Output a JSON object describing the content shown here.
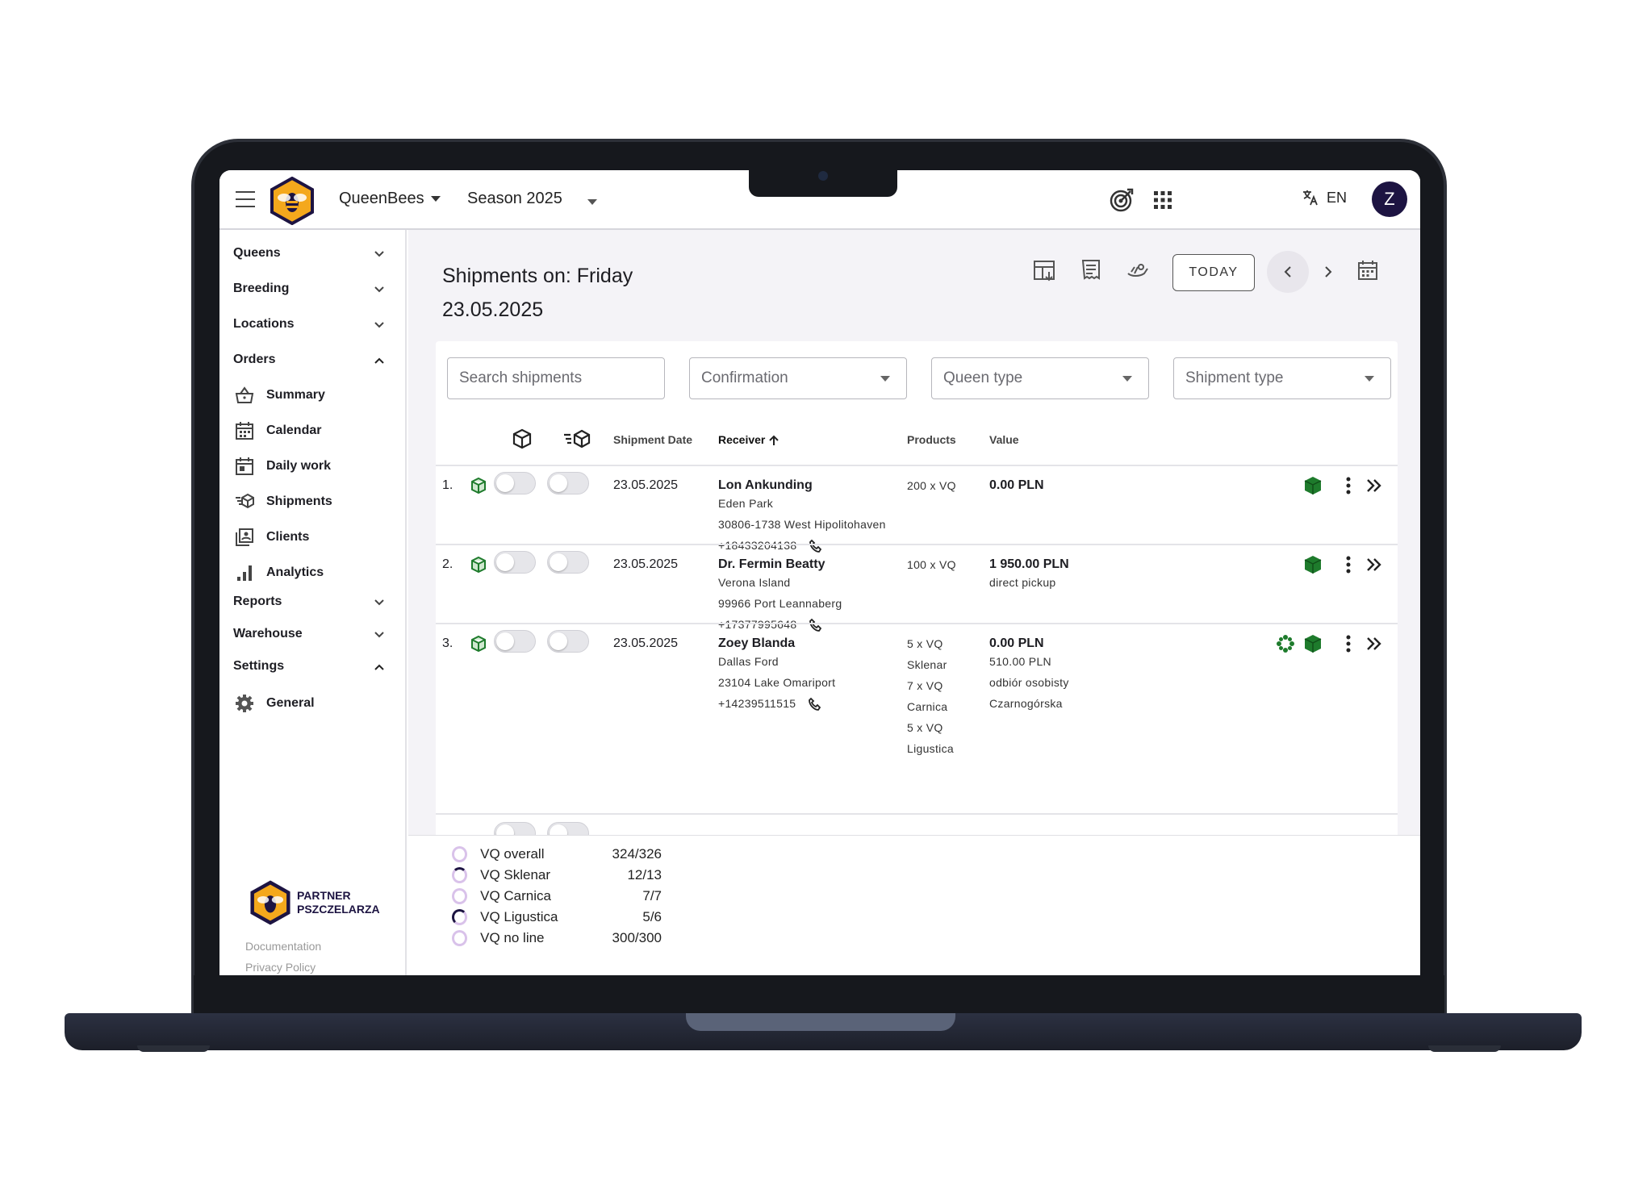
{
  "topbar": {
    "org": "QueenBees",
    "season": "Season 2025",
    "lang": "EN",
    "avatar": "Z"
  },
  "sidebar": {
    "groups": [
      {
        "label": "Queens"
      },
      {
        "label": "Breeding"
      },
      {
        "label": "Locations"
      },
      {
        "label": "Orders"
      },
      {
        "label": "Reports"
      },
      {
        "label": "Warehouse"
      },
      {
        "label": "Settings"
      }
    ],
    "order_items": [
      {
        "label": "Summary",
        "icon": "basket-icon"
      },
      {
        "label": "Calendar",
        "icon": "calendar-icon"
      },
      {
        "label": "Daily work",
        "icon": "daily-work-icon"
      },
      {
        "label": "Shipments",
        "icon": "shipments-icon"
      },
      {
        "label": "Clients",
        "icon": "clients-icon"
      },
      {
        "label": "Analytics",
        "icon": "analytics-icon"
      }
    ],
    "settings_items": [
      {
        "label": "General",
        "icon": "gear-icon"
      }
    ],
    "partner": {
      "line1": "PARTNER",
      "line2": "PSZCZELARZA"
    },
    "links": {
      "documentation": "Documentation",
      "privacy": "Privacy Policy"
    }
  },
  "main": {
    "title_line1": "Shipments on: Friday",
    "title_line2": "23.05.2025",
    "today_label": "TODAY",
    "filters": {
      "search": "Search shipments",
      "confirmation": "Confirmation",
      "queen_type": "Queen type",
      "shipment_type": "Shipment type"
    },
    "columns": {
      "date": "Shipment Date",
      "receiver": "Receiver",
      "products": "Products",
      "value": "Value"
    },
    "rows": [
      {
        "num": "1.",
        "date": "23.05.2025",
        "name": "Lon Ankunding",
        "addr1": "Eden Park",
        "addr2": "30806-1738 West Hipolitohaven",
        "phone": "+18433204138",
        "products": [
          "200 x VQ"
        ],
        "value": "0.00 PLN",
        "value_notes": []
      },
      {
        "num": "2.",
        "date": "23.05.2025",
        "name": "Dr. Fermin Beatty",
        "addr1": "Verona Island",
        "addr2": "99966 Port Leannaberg",
        "phone": "+17377995648",
        "products": [
          "100 x VQ"
        ],
        "value": "1 950.00 PLN",
        "value_notes": [
          "direct pickup"
        ]
      },
      {
        "num": "3.",
        "date": "23.05.2025",
        "name": "Zoey Blanda",
        "addr1": "Dallas Ford",
        "addr2": "23104 Lake Omariport",
        "phone": "+14239511515",
        "products": [
          "5 x VQ",
          "Sklenar",
          "7 x VQ",
          "Carnica",
          "5 x VQ",
          "Ligustica"
        ],
        "value": "0.00 PLN",
        "value_notes": [
          "510.00 PLN",
          "odbiór osobisty",
          "Czarnogórska"
        ]
      }
    ],
    "summary": [
      {
        "label": "VQ overall",
        "value": "324/326"
      },
      {
        "label": "VQ Sklenar",
        "value": "12/13"
      },
      {
        "label": "VQ Carnica",
        "value": "7/7"
      },
      {
        "label": "VQ Ligustica",
        "value": "5/6"
      },
      {
        "label": "VQ no line",
        "value": "300/300"
      }
    ]
  },
  "colors": {
    "accent": "#1d1442",
    "green": "#1e7b2c",
    "logo_yellow": "#f4a81c"
  }
}
